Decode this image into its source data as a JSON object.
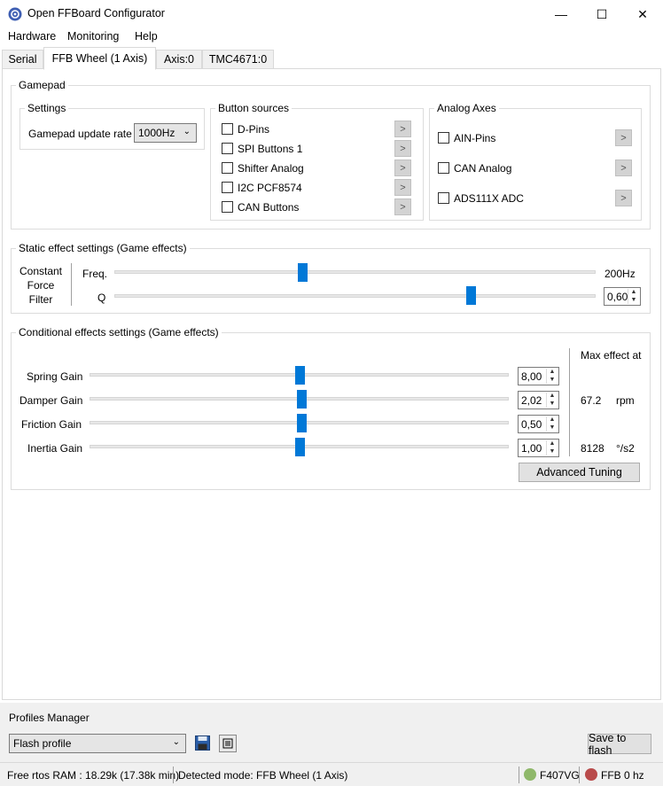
{
  "window": {
    "title": "Open FFBoard Configurator",
    "minimize": "—",
    "maximize": "☐",
    "close": "✕"
  },
  "menu": [
    "Hardware",
    "Monitoring",
    "Help"
  ],
  "tabs": [
    "Serial",
    "FFB Wheel (1 Axis)",
    "Axis:0",
    "TMC4671:0"
  ],
  "gamepad": {
    "title": "Gamepad",
    "settings": {
      "title": "Settings",
      "rate_label": "Gamepad update rate",
      "rate_value": "1000Hz"
    },
    "button_sources": {
      "title": "Button sources",
      "items": [
        "D-Pins",
        "SPI Buttons 1",
        "Shifter Analog",
        "I2C PCF8574",
        "CAN Buttons"
      ]
    },
    "analog_axes": {
      "title": "Analog Axes",
      "items": [
        "AIN-Pins",
        "CAN Analog",
        "ADS111X ADC"
      ]
    },
    "arrow": ">"
  },
  "static_effects": {
    "title": "Static effect settings (Game effects)",
    "filter_label_1": "Constant",
    "filter_label_2": "Force",
    "filter_label_3": "Filter",
    "freq_label": "Freq.",
    "freq_value": "200Hz",
    "freq_level": 0.39,
    "q_label": "Q",
    "q_value": "0,60",
    "q_level": 0.74
  },
  "conditional_effects": {
    "title": "Conditional effects settings (Game effects)",
    "max_effect_label": "Max effect at",
    "rows": [
      {
        "label": "Spring Gain",
        "value": "8,00",
        "level": 0.5,
        "max": "",
        "unit": ""
      },
      {
        "label": "Damper Gain",
        "value": "2,02",
        "level": 0.505,
        "max": "67.2",
        "unit": "rpm"
      },
      {
        "label": "Friction Gain",
        "value": "0,50",
        "level": 0.505,
        "max": "",
        "unit": ""
      },
      {
        "label": "Inertia Gain",
        "value": "1,00",
        "level": 0.5,
        "max": "8128",
        "unit": "°/s2"
      }
    ],
    "advanced_button": "Advanced Tuning"
  },
  "profiles": {
    "title": "Profiles Manager",
    "selected": "Flash profile",
    "save_to_flash": "Save to flash"
  },
  "status": {
    "ram": "Free rtos RAM : 18.29k (17.38k min)",
    "mode": "Detected mode: FFB Wheel (1 Axis)",
    "board": "F407VG",
    "ffb": "FFB 0 hz",
    "board_led_color": "#8fb86a",
    "ffb_led_color": "#b94b4b"
  },
  "colors": {
    "accent": "#0078d7"
  }
}
